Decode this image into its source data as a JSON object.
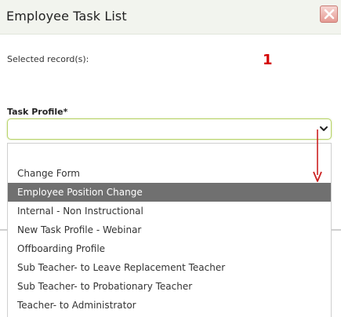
{
  "dialog": {
    "title": "Employee Task List",
    "close_icon": "close-icon"
  },
  "selected": {
    "label": "Selected record(s):",
    "count": "1"
  },
  "task_profile": {
    "label": "Task Profile*",
    "value": "",
    "options": [
      "",
      "Change Form",
      "Employee Position Change",
      "Internal - Non Instructional",
      "New Task Profile - Webinar",
      "Offboarding Profile",
      "Sub Teacher- to Leave Replacement Teacher",
      "Sub Teacher- to Probationary Teacher",
      "Teacher- to Administrator"
    ],
    "highlighted_option": "Employee Position Change"
  },
  "colors": {
    "highlight_bg": "#707070",
    "count_red": "#d40000",
    "focus_border": "#b9d46a",
    "annotation_arrow": "#cc2222"
  }
}
